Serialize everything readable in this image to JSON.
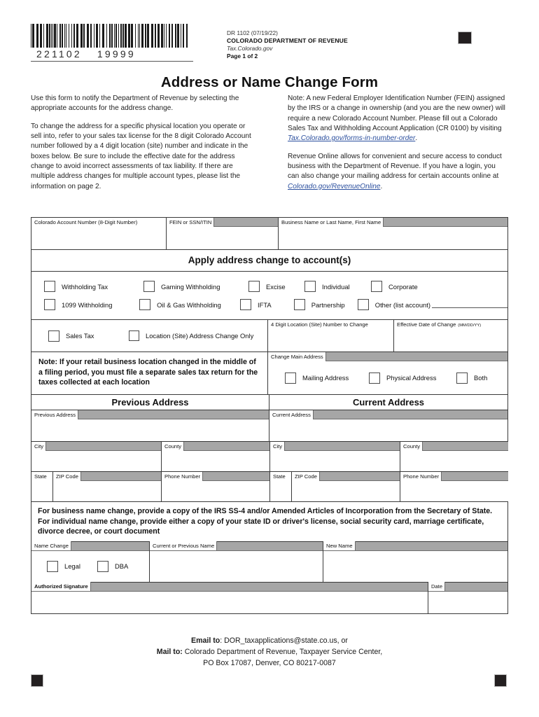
{
  "header": {
    "barcode_digits_left": "221102",
    "barcode_digits_right": "19999",
    "form_id": "DR 1102 (07/19/22)",
    "department": "COLORADO DEPARTMENT OF REVENUE",
    "website": "Tax.Colorado.gov",
    "page_label": "Page 1 of 2"
  },
  "title": "Address or Name Change Form",
  "intro": {
    "left_p1": "Use this form to notify the Department of Revenue by selecting the appropriate accounts for the address change.",
    "left_p2": "To change the address for a specific physical location you operate or sell into, refer to your sales tax license for the 8 digit Colorado Account number followed by a 4 digit location (site) number and indicate in the boxes below.  Be sure to include the effective date for the address change to avoid incorrect assessments of tax liability.  If there are multiple address changes for multiple account types, please list the information on page 2.",
    "right_p1_a": "Note: A new Federal Employer Identification Number (FEIN) assigned by the IRS or a change in ownership (and you are the new owner) will require a new Colorado Account Number. Please fill out a Colorado Sales Tax and Withholding Account Application (CR 0100) by visiting ",
    "right_p1_link": "Tax.Colorado.gov/forms-in-number-order",
    "right_p1_b": ".",
    "right_p2_a": "Revenue Online allows for convenient and secure access to conduct business with the Department of Revenue.  If you have a login, you can also change your mailing address for certain accounts online at ",
    "right_p2_link": "Colorado.gov/RevenueOnline",
    "right_p2_b": "."
  },
  "form": {
    "account_number_label": "Colorado Account Number (8-Digit Number)",
    "fein_label": "FEIN or SSN/ITIN",
    "business_name_label": "Business Name or Last Name, First Name",
    "account_number_value": "",
    "fein_value": "",
    "business_name_value": "",
    "apply_banner": "Apply address change to account(s)",
    "account_checkboxes_row1": [
      "Withholding Tax",
      "Gaming Withholding",
      "Excise",
      "Individual",
      "Corporate"
    ],
    "account_checkboxes_row2": [
      "1099 Withholding",
      "Oil & Gas Withholding",
      "IFTA",
      "Partnership",
      "Other (list account)"
    ],
    "sales_tax_label": "Sales Tax",
    "location_change_label": "Location (Site) Address Change Only",
    "location_number_label": "4 Digit Location (Site) Number to Change",
    "effective_date_label": "Effective Date of Change",
    "effective_date_format": "(MM/DD/YY)",
    "location_number_value": "",
    "effective_date_value": "",
    "retail_note": "Note: If your retail business location changed in the middle of a filing period, you must file a separate sales tax return for the taxes collected at each location",
    "change_main_address_label": "Change Main Address",
    "main_address_options": [
      "Mailing Address",
      "Physical Address",
      "Both"
    ],
    "previous_address_title": "Previous Address",
    "current_address_title": "Current Address",
    "previous_address_label": "Previous Address",
    "current_address_label": "Current Address",
    "previous_address_value": "",
    "current_address_value": "",
    "city_label": "City",
    "county_label": "County",
    "state_label": "State",
    "zip_label": "ZIP Code",
    "phone_label": "Phone Number",
    "prev_city_value": "",
    "prev_county_value": "",
    "prev_state_value": "",
    "prev_zip_value": "",
    "prev_phone_value": "",
    "curr_city_value": "",
    "curr_county_value": "",
    "curr_state_value": "",
    "curr_zip_value": "",
    "curr_phone_value": "",
    "name_change_instructions_line1": "For business name change, provide a copy of the IRS SS-4 and/or Amended Articles of Incorporation from the Secretary of State.",
    "name_change_instructions_line2": "For individual name change, provide either a copy of your state ID or driver's license, social security card, marriage certificate, divorce decree, or court document",
    "name_change_label": "Name Change",
    "current_or_previous_name_label": "Current or Previous Name",
    "new_name_label": "New Name",
    "legal_label": "Legal",
    "dba_label": "DBA",
    "current_or_previous_name_value": "",
    "new_name_value": "",
    "authorized_signature_label": "Authorized Signature",
    "date_label": "Date",
    "authorized_signature_value": "",
    "date_value": ""
  },
  "footer": {
    "email_bold": "Email to",
    "email_rest": ": DOR_taxapplications@state.co.us, or",
    "mail_bold": "Mail to:",
    "mail_rest": " Colorado Department of Revenue, Taxpayer Service Center,",
    "mail_line2": "PO Box 17087, Denver, CO 80217-0087"
  },
  "colors": {
    "label_gray": "#a6a6a6",
    "border": "#3a3a3a",
    "link": "#2b4f9e",
    "reg_mark": "#231f20"
  }
}
